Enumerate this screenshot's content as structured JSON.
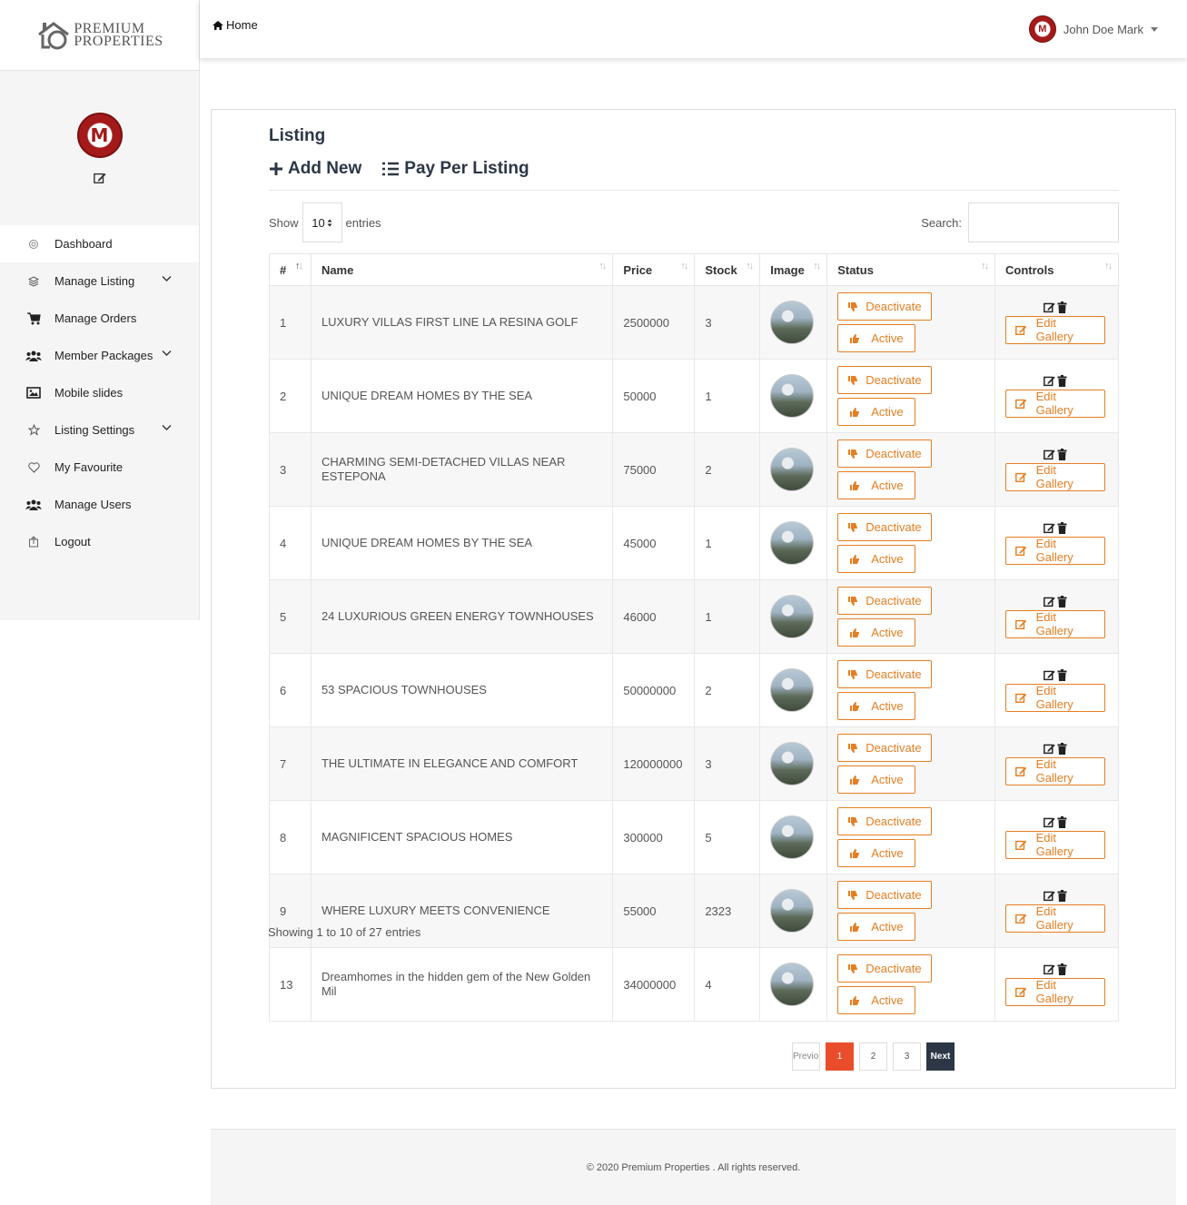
{
  "brand": {
    "line1": "PREMIUM",
    "line2": "PROPERTIES"
  },
  "header": {
    "home_label": "Home",
    "user_name": "John Doe Mark"
  },
  "sidebar": {
    "items": [
      {
        "label": "Dashboard",
        "icon": "dashboard-icon"
      },
      {
        "label": "Manage Listing",
        "icon": "layers-icon"
      },
      {
        "label": "Manage Orders",
        "icon": "cart-icon"
      },
      {
        "label": "Member Packages",
        "icon": "users-icon"
      },
      {
        "label": "Mobile slides",
        "icon": "image-icon"
      },
      {
        "label": "Listing Settings",
        "icon": "star-icon"
      },
      {
        "label": "My Favourite",
        "icon": "heart-icon"
      },
      {
        "label": "Manage Users",
        "icon": "users-icon"
      },
      {
        "label": "Logout",
        "icon": "logout-icon"
      }
    ]
  },
  "main": {
    "title": "Listing",
    "add_new": "Add New",
    "pay_per_listing": "Pay Per Listing",
    "show_label": "Show",
    "entries_value": "10",
    "entries_label": "entries",
    "search_label": "Search:",
    "columns": [
      "#",
      "Name",
      "Price",
      "Stock",
      "Image",
      "Status",
      "Controls"
    ],
    "rows": [
      {
        "id": "1",
        "name": "LUXURY VILLAS FIRST LINE LA RESINA GOLF",
        "price": "2500000",
        "stock": "3"
      },
      {
        "id": "2",
        "name": "UNIQUE DREAM HOMES BY THE SEA",
        "price": "50000",
        "stock": "1"
      },
      {
        "id": "3",
        "name": "CHARMING SEMI-DETACHED VILLAS NEAR ESTEPONA",
        "price": "75000",
        "stock": "2"
      },
      {
        "id": "4",
        "name": "UNIQUE DREAM HOMES BY THE SEA",
        "price": "45000",
        "stock": "1"
      },
      {
        "id": "5",
        "name": "24 LUXURIOUS GREEN ENERGY TOWNHOUSES",
        "price": "46000",
        "stock": "1"
      },
      {
        "id": "6",
        "name": "53 SPACIOUS TOWNHOUSES",
        "price": "50000000",
        "stock": "2"
      },
      {
        "id": "7",
        "name": "THE ULTIMATE IN ELEGANCE AND COMFORT",
        "price": "120000000",
        "stock": "3"
      },
      {
        "id": "8",
        "name": "MAGNIFICENT SPACIOUS HOMES",
        "price": "300000",
        "stock": "5"
      },
      {
        "id": "9",
        "name": "WHERE LUXURY MEETS CONVENIENCE",
        "price": "55000",
        "stock": "2323"
      },
      {
        "id": "13",
        "name": "Dreamhomes in the hidden gem of the New Golden Mil",
        "price": "34000000",
        "stock": "4"
      }
    ],
    "deactivate_label": "Deactivate",
    "active_label": "Active",
    "edit_gallery_label": "Edit Gallery",
    "info": "Showing 1 to 10 of 27 entries",
    "pagination": {
      "prev": "Previous",
      "pages": [
        "1",
        "2",
        "3"
      ],
      "next": "Next"
    }
  },
  "footer": {
    "text": "© 2020 Premium Properties . All rights reserved."
  },
  "colors": {
    "accent": "#e67e22",
    "current_page": "#ea4d2c",
    "dark": "#2c3746"
  }
}
